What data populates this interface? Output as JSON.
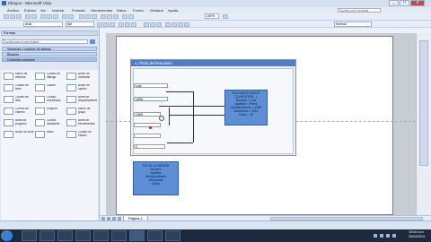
{
  "window": {
    "title": "Dibujo1 - Microsoft Visio",
    "minimize": "_",
    "maximize": "□",
    "close": "x"
  },
  "menubar": {
    "items": [
      "Archivo",
      "Edición",
      "Ver",
      "Insertar",
      "Formato",
      "Herramientas",
      "Datos",
      "Forma",
      "Ventana",
      "Ayuda"
    ],
    "help_placeholder": "Escriba una pregunta"
  },
  "toolbar": {
    "zoom": "100%",
    "font": "Arial",
    "font_size": "8pt",
    "style": "Normal"
  },
  "left_pane": {
    "header": "Formas",
    "search_label": "Buscar formas",
    "search_placeholder": "Escriba aquí lo que busca",
    "stencils": [
      "Ventanas y cuadros de diálogo",
      "Bloques",
      "Controles comunes"
    ],
    "shapes": [
      "Marco de ventana",
      "Cuadro de diálogo",
      "Botón de comando",
      "Cuadro de texto",
      "Casilla",
      "Botón de opción",
      "Cuadro de lista",
      "Cuadro combinado",
      "Barra de desplazamiento",
      "Control de número",
      "Etiqueta",
      "Marco de grupo",
      "Barra de progreso",
      "Control deslizante",
      "Barra de herramientas",
      "Botón de ficha",
      "Menú",
      "Cuadro de estado"
    ]
  },
  "diagram": {
    "dialog_title": "1. Título del formulario",
    "fields": [
      "Luis",
      "1995",
      "1969",
      "",
      "",
      "0"
    ],
    "code_box_1": [
      "DOCUMENT.WRITE",
      "CLASSIFIER(...)",
      "Nombre = Luis",
      "Apellido = Pérez",
      "AñoNacimiento = 1995",
      "AñoActual = 2013",
      "Edad = 18"
    ],
    "code_box_2": [
      "FIN DE LA SESIÓN",
      "Nombre",
      "Apellido",
      "AñoNacimiento",
      "AñoActual",
      "Edad"
    ]
  },
  "bottombar": {
    "page_tab": "Página-1"
  },
  "taskbar": {
    "time": "09:40 a.m.",
    "date": "23/04/2013"
  }
}
